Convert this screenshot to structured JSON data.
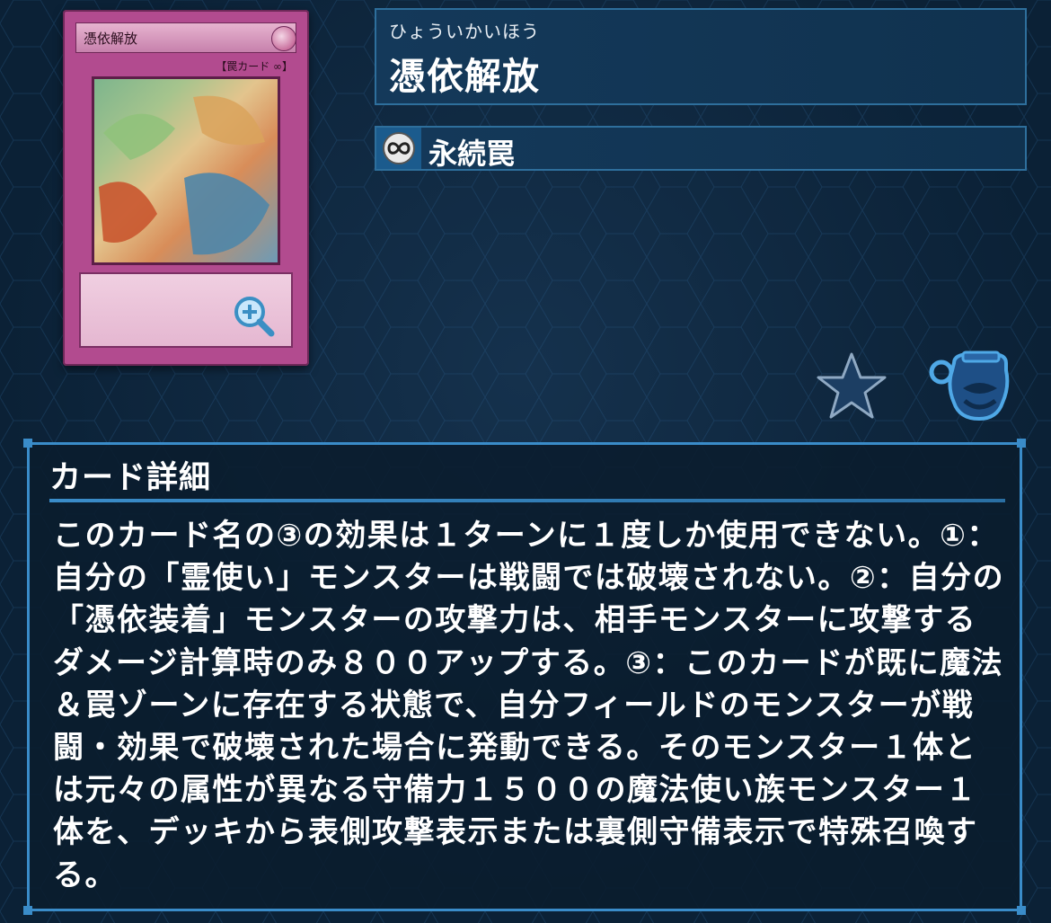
{
  "card": {
    "ruby": "ひょういかいほう",
    "name": "憑依解放",
    "art_name": "憑依解放",
    "art_type_line": "【罠カード ∞】",
    "type": "永続罠",
    "type_icon": "infinity-icon"
  },
  "details": {
    "heading": "カード詳細",
    "effect_text": "このカード名の③の効果は１ターンに１度しか使用できない。①：自分の「霊使い」モンスターは戦闘では破壊されない。②：自分の「憑依装着」モンスターの攻撃力は、相手モンスターに攻撃するダメージ計算時のみ８００アップする。③：このカードが既に魔法＆罠ゾーンに存在する状態で、自分フィールドのモンスターが戦闘・効果で破壊された場合に発動できる。そのモンスター１体とは元々の属性が異なる守備力１５００の魔法使い族モンスター１体を、デッキから表側攻撃表示または裏側守備表示で特殊召喚する。"
  },
  "icons": {
    "zoom": "zoom-in-icon",
    "favorite": "star-icon",
    "collection": "pot-of-greed-icon"
  },
  "colors": {
    "background": "#0b2136",
    "accent": "#3a8cc9",
    "trap_card": "#b24b8f"
  }
}
